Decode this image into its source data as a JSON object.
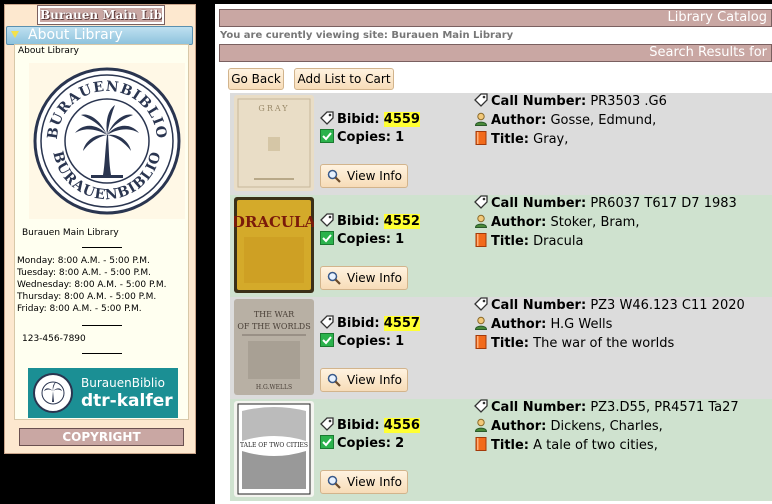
{
  "sidebar": {
    "library_name": "Burauen Main Library",
    "about_tab": "About Library",
    "about_link": "About Library",
    "logo_text_top": "BURAUENBIBLIO",
    "logo_text_bottom": "BURAUENBIBLIO",
    "branch_name": "Burauen Main Library",
    "hours": [
      "Monday: 8:00 A.M. - 5:00 P.M.",
      "Tuesday: 8:00 A.M. - 5:00 P.M.",
      "Wednesday: 8:00 A.M. - 5:00 P.M.",
      "Thursday: 8:00 A.M. - 5:00 P.M.",
      "Friday: 8:00 A.M. - 5:00 P.M."
    ],
    "phone": "123-456-7890",
    "badge_line1": "BurauenBiblio",
    "badge_line2": "dtr-kalfer",
    "copyright": "COPYRIGHT"
  },
  "main": {
    "header": "Library Catalog",
    "site_line": "You are curently viewing site: Burauen Main Library",
    "results_header": "Search Results for",
    "go_back": "Go Back",
    "add_list": "Add List to Cart",
    "labels": {
      "bibid": "Bibid:",
      "copies": "Copies:",
      "call_number": "Call Number:",
      "author": "Author:",
      "title": "Title:",
      "view_info": "View Info"
    },
    "results": [
      {
        "bibid": "4559",
        "copies": "1",
        "call_number": "PR3503 .G6",
        "author": "Gosse, Edmund,",
        "title": "Gray,",
        "cover_title": "GRAY"
      },
      {
        "bibid": "4552",
        "copies": "1",
        "call_number": "PR6037 T617 D7 1983",
        "author": "Stoker, Bram,",
        "title": "Dracula",
        "cover_title": "DRACULA"
      },
      {
        "bibid": "4557",
        "copies": "1",
        "call_number": "PZ3 W46.123 C11 2020",
        "author": "H.G Wells",
        "title": "The war of the worlds",
        "cover_title": "THE WAR OF THE WORLDS"
      },
      {
        "bibid": "4556",
        "copies": "2",
        "call_number": "PZ3.D55, PR4571 Ta27",
        "author": "Dickens, Charles,",
        "title": "A tale of two cities,",
        "cover_title": "A TALE OF TWO CITIES"
      }
    ]
  },
  "colors": {
    "bar": "#c9a7a3",
    "sidebar_bg": "#fde8cf",
    "row_gray": "#dcdcdc",
    "row_green": "#cfe2cf",
    "highlight": "#ffff33",
    "badge": "#1b8f94"
  }
}
